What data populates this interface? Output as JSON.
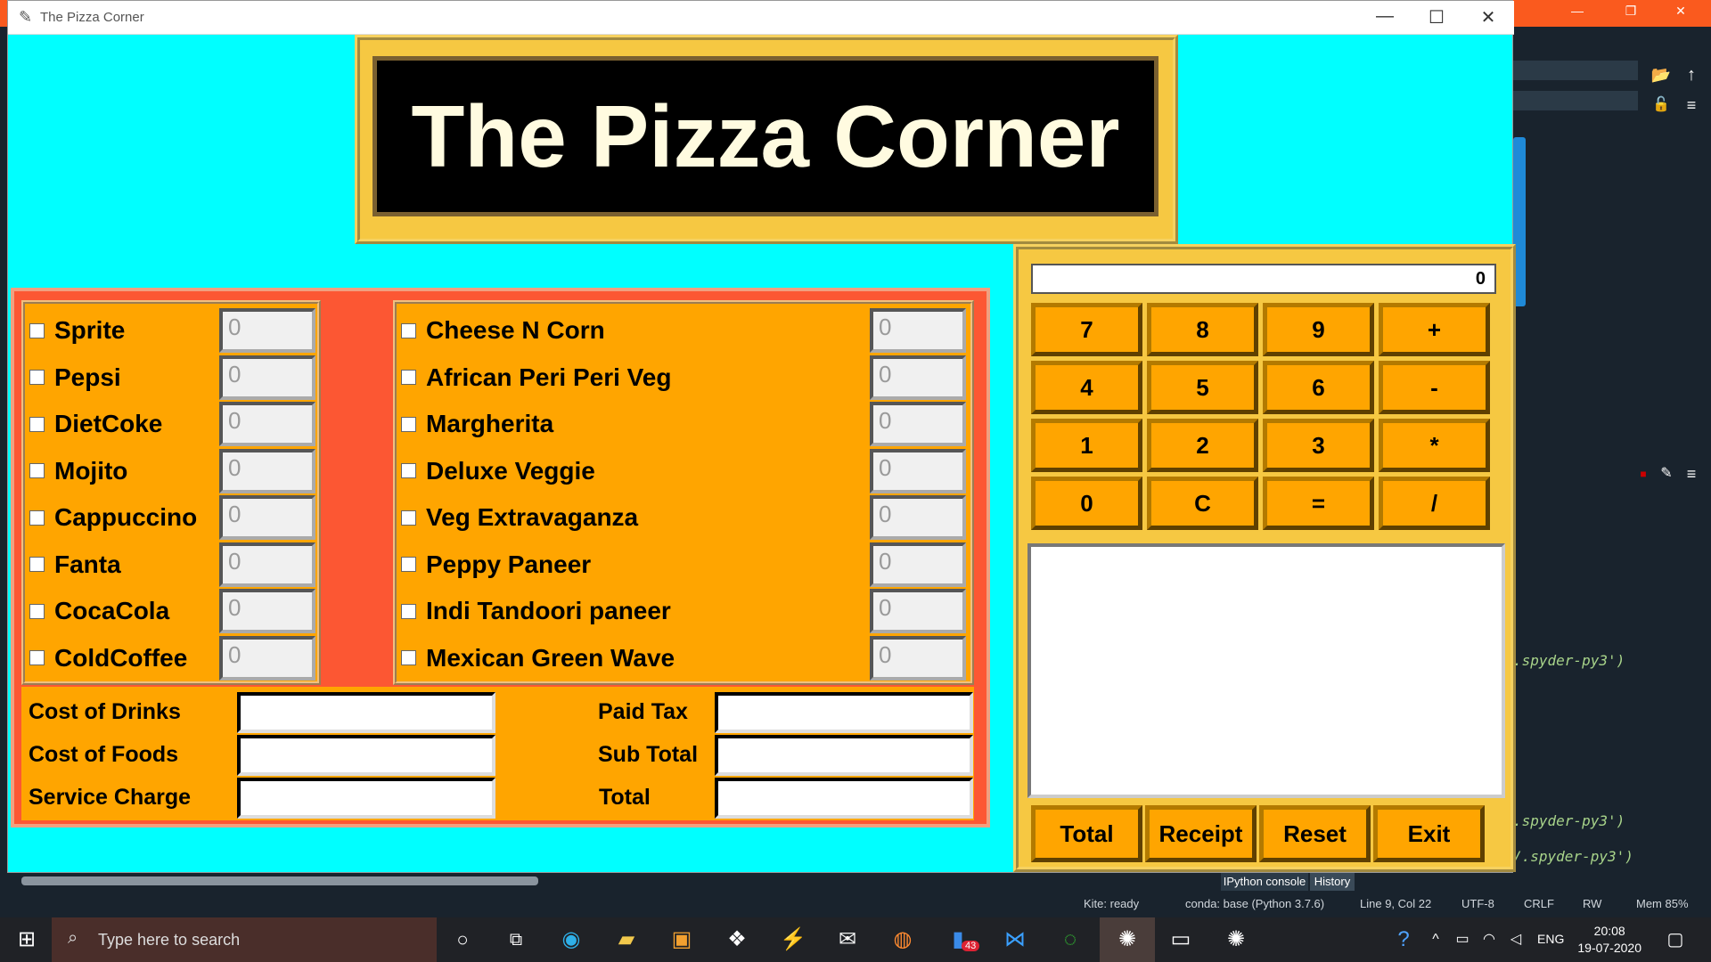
{
  "ide": {
    "code_lines": [
      ".spyder-py3')",
      ".spyder-py3')",
      "/.spyder-py3')"
    ],
    "tabs": [
      "IPython console",
      "History"
    ],
    "status": [
      "Kite: ready",
      "conda: base (Python 3.7.6)",
      "Line 9, Col 22",
      "UTF-8",
      "CRLF",
      "RW",
      "Mem 85%"
    ]
  },
  "window": {
    "title": "The Pizza Corner"
  },
  "banner": {
    "title": "The Pizza Corner"
  },
  "drinks": [
    {
      "name": "Sprite",
      "qty": "0"
    },
    {
      "name": "Pepsi",
      "qty": "0"
    },
    {
      "name": "DietCoke",
      "qty": "0"
    },
    {
      "name": "Mojito",
      "qty": "0"
    },
    {
      "name": "Cappuccino",
      "qty": "0"
    },
    {
      "name": "Fanta",
      "qty": "0"
    },
    {
      "name": "CocaCola",
      "qty": "0"
    },
    {
      "name": "ColdCoffee",
      "qty": "0"
    }
  ],
  "foods": [
    {
      "name": "Cheese N Corn",
      "qty": "0"
    },
    {
      "name": "African Peri Peri Veg",
      "qty": "0"
    },
    {
      "name": "Margherita",
      "qty": "0"
    },
    {
      "name": "Deluxe Veggie",
      "qty": "0"
    },
    {
      "name": "Veg Extravaganza",
      "qty": "0"
    },
    {
      "name": "Peppy Paneer",
      "qty": "0"
    },
    {
      "name": "Indi Tandoori paneer",
      "qty": "0"
    },
    {
      "name": "Mexican Green Wave",
      "qty": "0"
    }
  ],
  "costs": {
    "cost_drinks": "Cost of Drinks",
    "cost_foods": "Cost of Foods",
    "service": "Service Charge",
    "paid_tax": "Paid Tax",
    "sub_total": "Sub Total",
    "total": "Total"
  },
  "calculator": {
    "display": "0",
    "keys": [
      "7",
      "8",
      "9",
      "+",
      "4",
      "5",
      "6",
      "-",
      "1",
      "2",
      "3",
      "*",
      "0",
      "C",
      "=",
      "/"
    ]
  },
  "actions": [
    "Total",
    "Receipt",
    "Reset",
    "Exit"
  ],
  "taskbar": {
    "search_placeholder": "Type here to search",
    "mail_badge": "43",
    "lang": "ENG",
    "time": "20:08",
    "date": "19-07-2020"
  }
}
